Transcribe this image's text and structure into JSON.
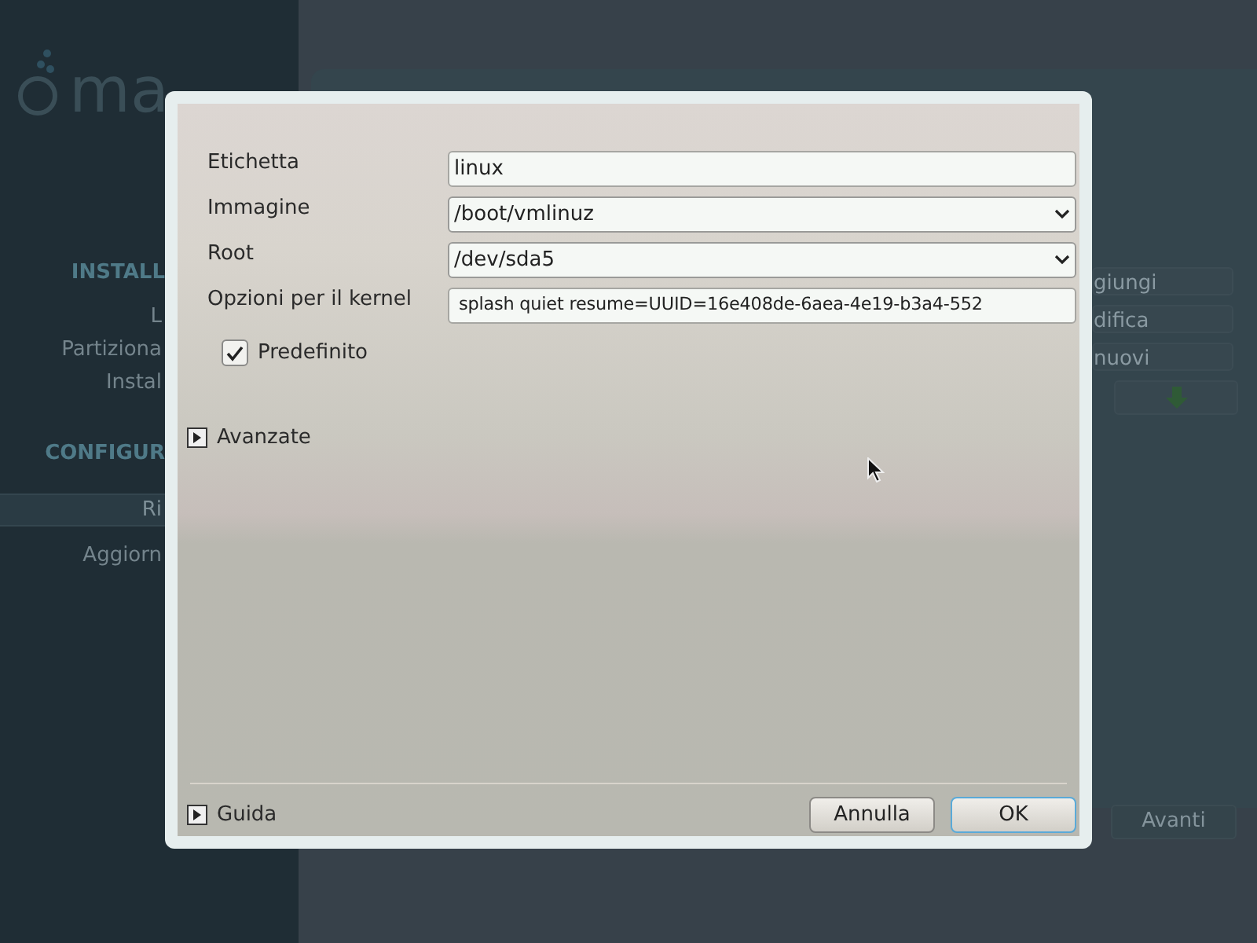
{
  "background": {
    "logo_text": "ma",
    "sidebar": [
      {
        "label": "INSTALL",
        "kind": "heading"
      },
      {
        "label": "L",
        "kind": "item",
        "selected": false
      },
      {
        "label": "Partiziona",
        "kind": "item",
        "selected": false
      },
      {
        "label": "Instal",
        "kind": "item",
        "selected": false
      },
      {
        "label": "CONFIGUR",
        "kind": "heading"
      },
      {
        "label": "Ri",
        "kind": "item",
        "selected": true
      },
      {
        "label": "Aggiorn",
        "kind": "item",
        "selected": false
      }
    ],
    "side_buttons": [
      "giungi",
      "difica",
      "nuovi"
    ],
    "next_button": "Avanti"
  },
  "dialog": {
    "fields": [
      {
        "label": "Etichetta",
        "kind": "text",
        "value": "linux"
      },
      {
        "label": "Immagine",
        "kind": "combo",
        "value": "/boot/vmlinuz"
      },
      {
        "label": "Root",
        "kind": "combo",
        "value": "/dev/sda5"
      },
      {
        "label": "Opzioni per il kernel",
        "kind": "text",
        "value": "splash quiet resume=UUID=16e408de-6aea-4e19-b3a4-552"
      }
    ],
    "default_checkbox": {
      "label": "Predefinito",
      "checked": true
    },
    "advanced": {
      "label": "Avanzate",
      "expanded": false
    },
    "help": {
      "label": "Guida",
      "expanded": false
    },
    "buttons": [
      {
        "label": "Annulla",
        "default": false
      },
      {
        "label": "OK",
        "default": true
      }
    ]
  }
}
